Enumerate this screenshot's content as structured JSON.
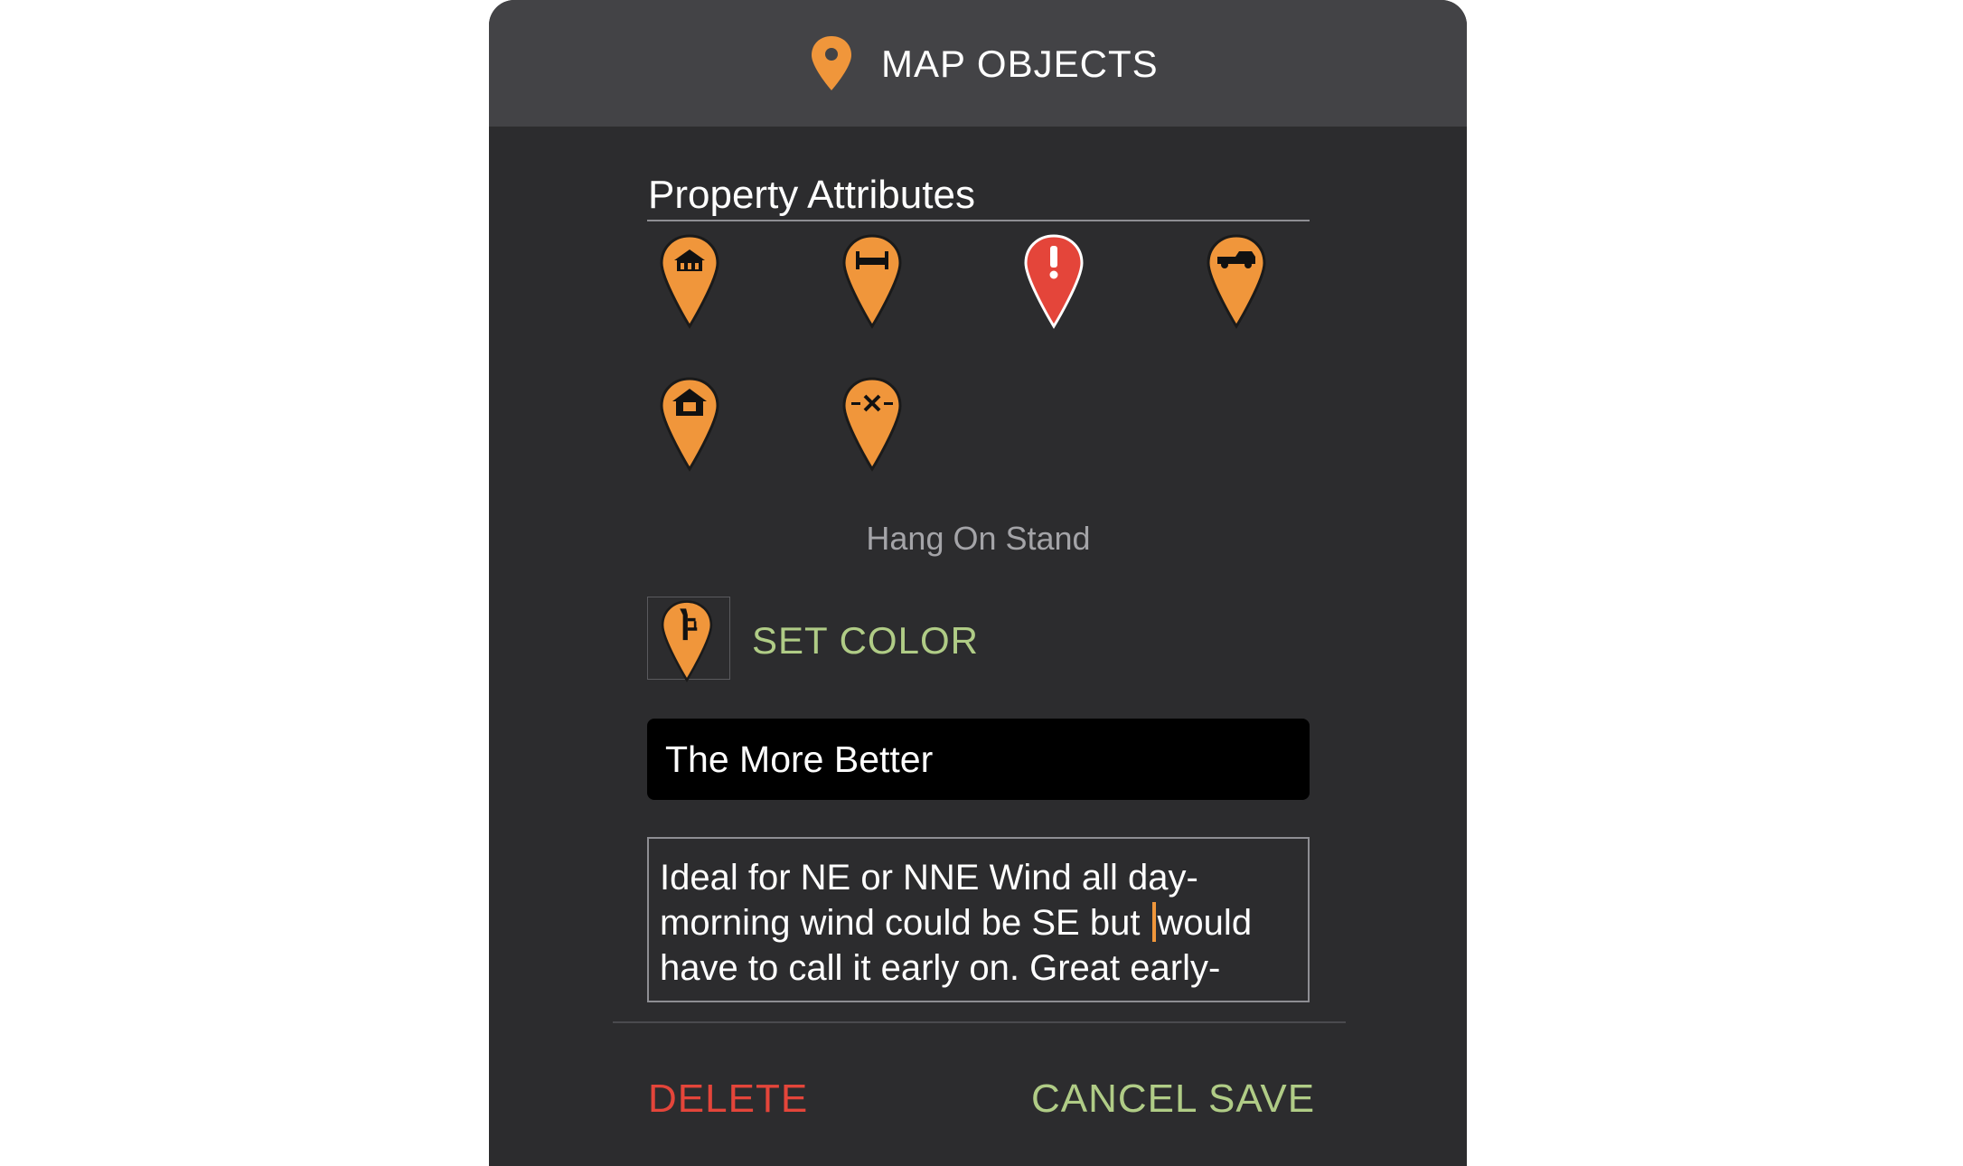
{
  "header": {
    "title": "MAP OBJECTS",
    "icon": "map-pin-icon"
  },
  "section": {
    "title": "Property Attributes"
  },
  "attribute_icons": [
    {
      "name": "cabin-marker-icon",
      "color": "#f0963b"
    },
    {
      "name": "bed-marker-icon",
      "color": "#f0963b"
    },
    {
      "name": "alert-marker-icon",
      "color": "#e4453a"
    },
    {
      "name": "truck-marker-icon",
      "color": "#f0963b"
    },
    {
      "name": "house-marker-icon",
      "color": "#f0963b"
    },
    {
      "name": "gate-marker-icon",
      "color": "#f0963b"
    }
  ],
  "selected": {
    "name": "Hang On Stand",
    "icon": "hang-on-stand-icon"
  },
  "set_color_label": "SET COLOR",
  "name_field": {
    "value": "The More Better"
  },
  "notes_field": {
    "text_before_caret": "Ideal for NE or NNE Wind all day-morning wind could be SE but ",
    "text_after_caret": "would have to call it early on. Great early-season spot"
  },
  "buttons": {
    "delete": "DELETE",
    "cancel": "CANCEL",
    "save": "SAVE"
  },
  "colors": {
    "accent_orange": "#f0963b",
    "alert_red": "#e4453a",
    "action_green": "#b0cc86",
    "dialog_bg": "#2c2c2e",
    "header_bg": "#434346"
  }
}
